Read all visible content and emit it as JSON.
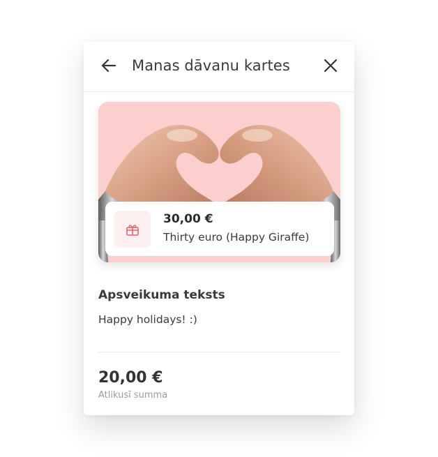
{
  "header": {
    "title": "Manas dāvanu kartes",
    "back_icon": "arrow-left-icon",
    "close_icon": "close-icon"
  },
  "gift_card": {
    "image": "heart-hands-illustration",
    "icon": "gift-icon",
    "amount": "30,00 €",
    "name": "Thirty euro (Happy Giraffe)"
  },
  "greeting": {
    "label": "Apsveikuma teksts",
    "text": "Happy holidays! :)"
  },
  "balance": {
    "amount": "20,00 €",
    "label": "Atlikusī summa"
  },
  "colors": {
    "card_background": "#fbcfcd",
    "gift_icon": "#e0656b",
    "gift_tile": "#fdf0f0",
    "muted_text": "#9a9a9a"
  }
}
